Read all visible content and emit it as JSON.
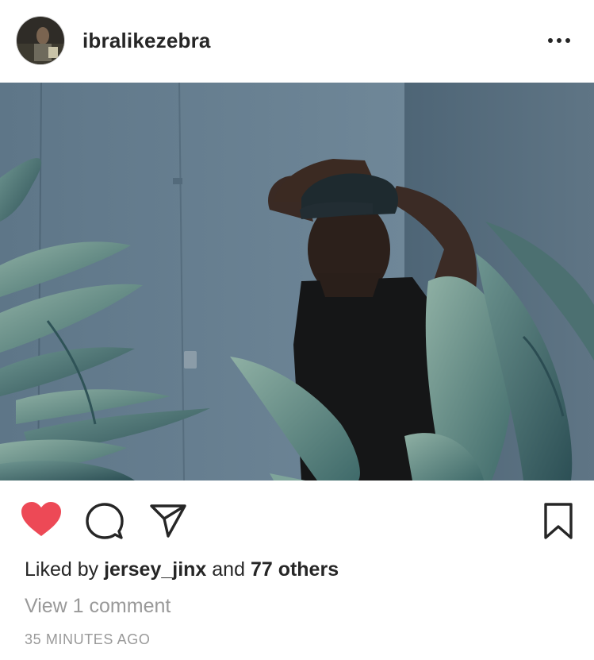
{
  "post": {
    "username": "ibralikezebra",
    "likes": {
      "prefix": "Liked by ",
      "first_liker": "jersey_jinx",
      "joiner": " and ",
      "others": "77 others"
    },
    "view_comments": "View 1 comment",
    "timestamp": "35 MINUTES AGO",
    "liked": true
  },
  "colors": {
    "like": "#ed4956",
    "text": "#262626",
    "muted": "#999999"
  },
  "icons": [
    "more-options-icon",
    "heart-icon",
    "comment-icon",
    "share-icon",
    "bookmark-icon"
  ]
}
